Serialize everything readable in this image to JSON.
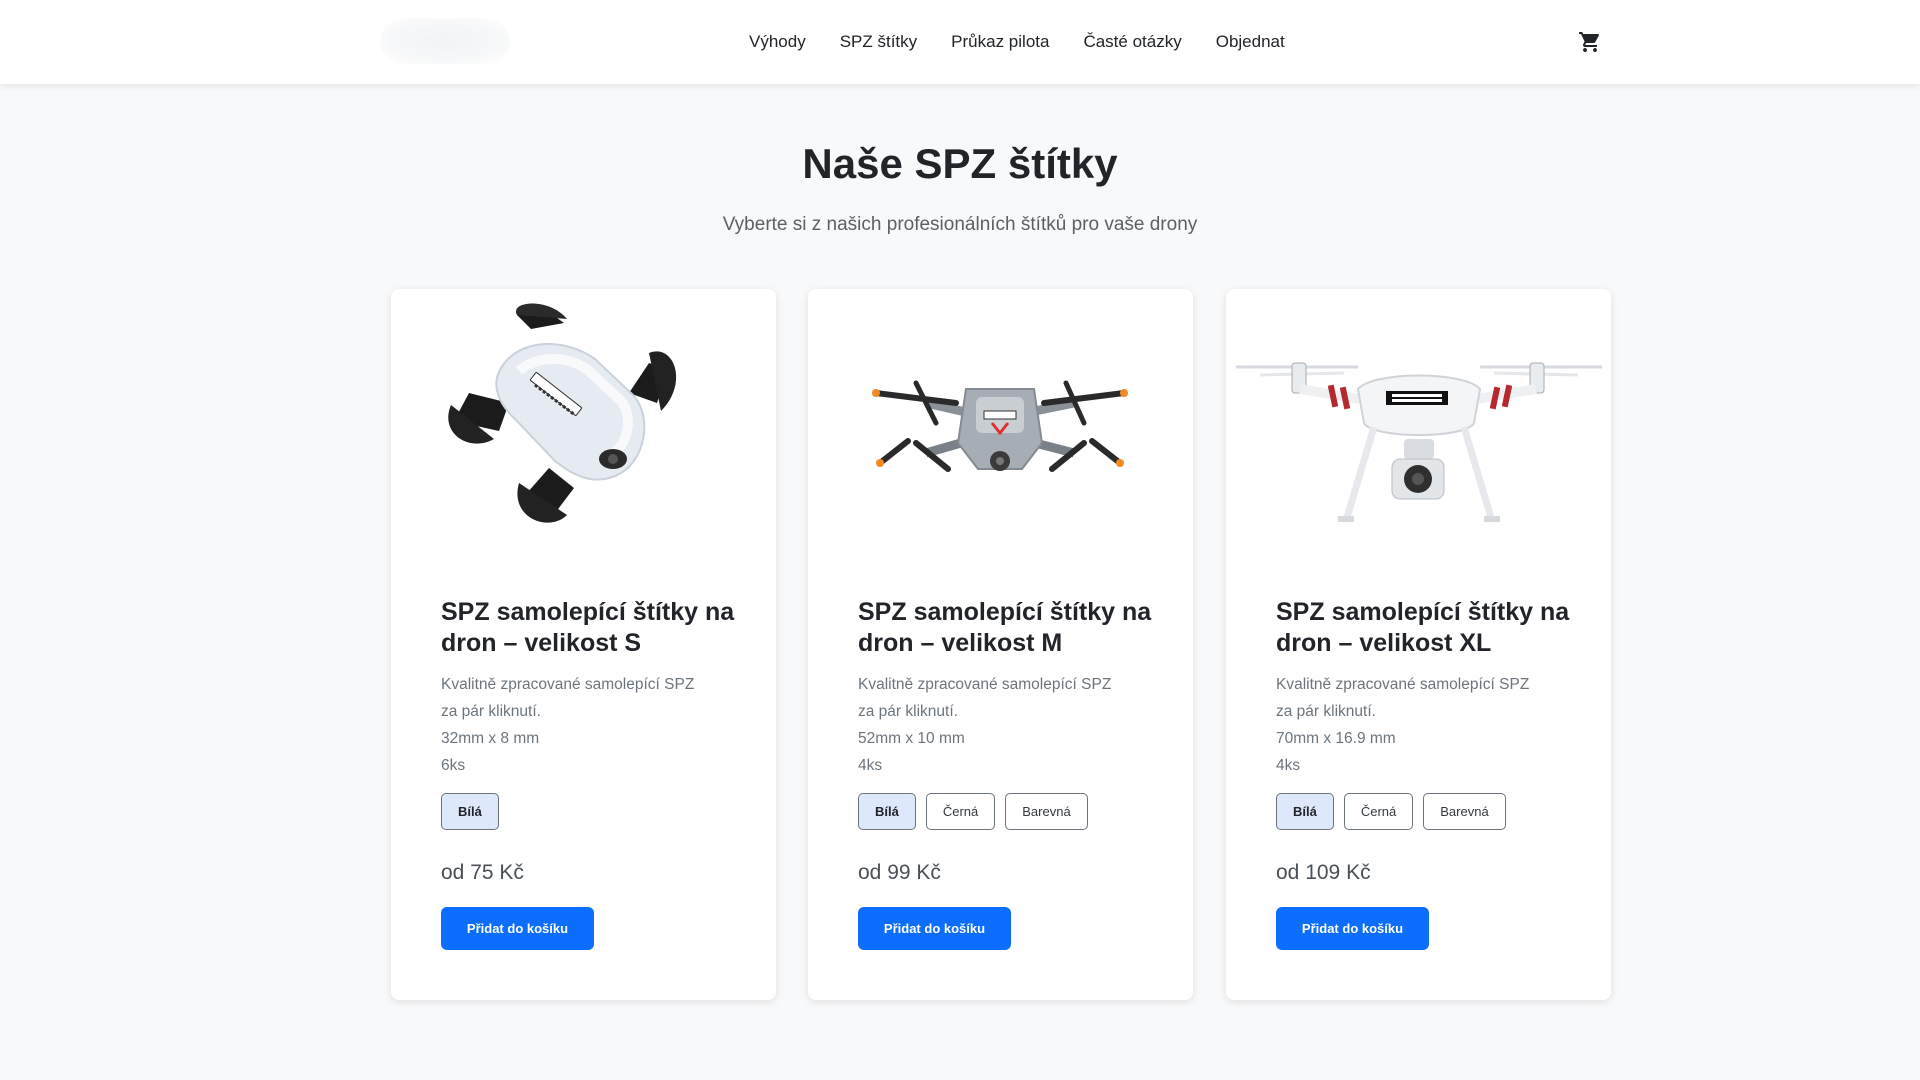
{
  "header": {
    "nav": [
      "Výhody",
      "SPZ štítky",
      "Průkaz pilota",
      "Časté otázky",
      "Objednat"
    ],
    "cart_icon": "shopping-cart-icon"
  },
  "section": {
    "title": "Naše SPZ štítky",
    "subtitle": "Vyberte si z našich profesionálních štítků pro vaše drony"
  },
  "products": [
    {
      "title": "SPZ samolepící štítky na dron – velikost S",
      "desc_line1": "Kvalitně zpracované samolepící SPZ",
      "desc_line2": "za pár kliknutí.",
      "size": "32mm x 8 mm",
      "qty": "6ks",
      "variants": [
        "Bílá"
      ],
      "selected_variant": "Bílá",
      "price": "od 75 Kč",
      "button": "Přidat do košíku",
      "image_icon": "folded-white-drone-image"
    },
    {
      "title": "SPZ samolepící štítky na dron – velikost M",
      "desc_line1": "Kvalitně zpracované samolepící SPZ",
      "desc_line2": "za pár kliknutí.",
      "size": "52mm x 10 mm",
      "qty": "4ks",
      "variants": [
        "Bílá",
        "Černá",
        "Barevná"
      ],
      "selected_variant": "Bílá",
      "price": "od 99 Kč",
      "button": "Přidat do košíku",
      "image_icon": "gray-quadcopter-drone-image"
    },
    {
      "title": "SPZ samolepící štítky na dron – velikost XL",
      "desc_line1": "Kvalitně zpracované samolepící SPZ",
      "desc_line2": "za pár kliknutí.",
      "size": "70mm x 16.9 mm",
      "qty": "4ks",
      "variants": [
        "Bílá",
        "Černá",
        "Barevná"
      ],
      "selected_variant": "Bílá",
      "price": "od 109 Kč",
      "button": "Přidat do košíku",
      "image_icon": "white-camera-drone-image"
    }
  ],
  "colors": {
    "primary": "#0d6efd",
    "selected_variant_bg": "#dde8fb",
    "page_bg": "#f8f9fa"
  }
}
